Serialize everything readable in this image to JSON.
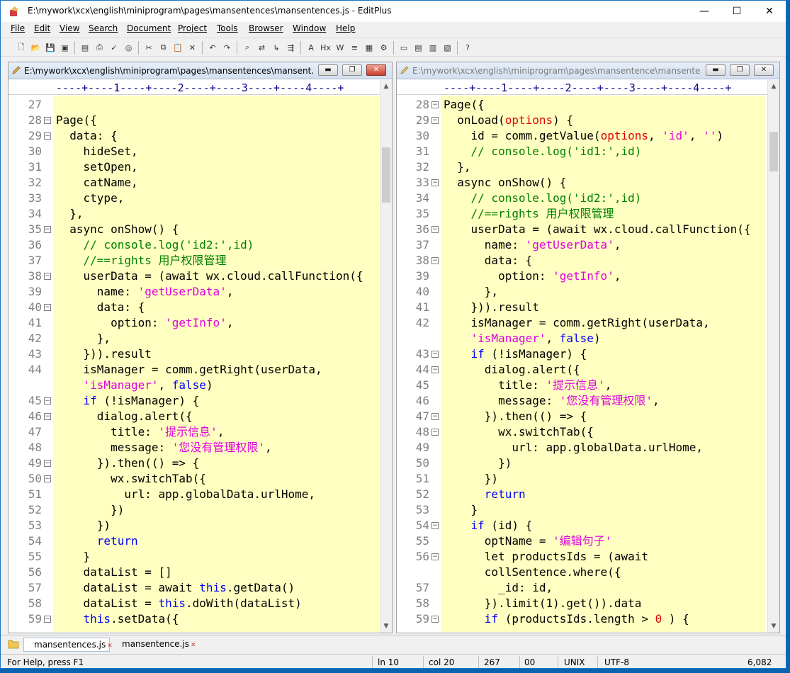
{
  "window": {
    "title": "E:\\mywork\\xcx\\english\\miniprogram\\pages\\mansentences\\mansentences.js - EditPlus",
    "minimize_glyph": "—",
    "maximize_glyph": "☐",
    "close_glyph": "✕"
  },
  "menu": [
    "File",
    "Edit",
    "View",
    "Search",
    "Document",
    "Project",
    "Tools",
    "Browser",
    "Window",
    "Help"
  ],
  "toolbar_icons": [
    "new-file-icon",
    "open-folder-icon",
    "save-icon",
    "save-all-icon",
    "print-preview-icon",
    "print-icon",
    "spell-check-icon",
    "browser-preview-icon",
    "cut-icon",
    "copy-icon",
    "paste-icon",
    "delete-icon",
    "undo-icon",
    "redo-icon",
    "find-icon",
    "replace-icon",
    "goto-icon",
    "find-in-files-icon",
    "font-icon",
    "hex-icon",
    "word-wrap-icon",
    "indent-icon",
    "column-select-icon",
    "settings-gear-icon",
    "doc-selector-icon",
    "output-window-icon",
    "cliptext-icon",
    "directory-icon",
    "help-pointer-icon"
  ],
  "left_pane": {
    "title": "E:\\mywork\\xcx\\english\\miniprogram\\pages\\mansentences\\mansent...",
    "ruler": "----+----1----+----2----+----3----+----4----+"
  },
  "right_pane": {
    "title": "E:\\mywork\\xcx\\english\\miniprogram\\pages\\mansentence\\mansente...",
    "ruler": "----+----1----+----2----+----3----+----4----+"
  },
  "left_code": [
    {
      "n": "27",
      "f": false,
      "t": []
    },
    {
      "n": "28",
      "f": true,
      "t": [
        [
          "",
          "Page({"
        ]
      ]
    },
    {
      "n": "29",
      "f": true,
      "t": [
        [
          "",
          "  data: {"
        ]
      ]
    },
    {
      "n": "30",
      "f": false,
      "t": [
        [
          "",
          "    hideSet,"
        ]
      ]
    },
    {
      "n": "31",
      "f": false,
      "t": [
        [
          "",
          "    setOpen,"
        ]
      ]
    },
    {
      "n": "32",
      "f": false,
      "t": [
        [
          "",
          "    catName,"
        ]
      ]
    },
    {
      "n": "33",
      "f": false,
      "t": [
        [
          "",
          "    ctype,"
        ]
      ]
    },
    {
      "n": "34",
      "f": false,
      "t": [
        [
          "",
          "  },"
        ]
      ]
    },
    {
      "n": "35",
      "f": true,
      "t": [
        [
          "",
          "  async onShow() {"
        ]
      ]
    },
    {
      "n": "36",
      "f": false,
      "t": [
        [
          "c",
          "    // console.log('id2:',id)"
        ]
      ]
    },
    {
      "n": "37",
      "f": false,
      "t": [
        [
          "c",
          "    //==rights 用户权限管理"
        ]
      ]
    },
    {
      "n": "38",
      "f": true,
      "t": [
        [
          "",
          "    userData = (await wx.cloud.callFunction({"
        ]
      ]
    },
    {
      "n": "39",
      "f": false,
      "t": [
        [
          "",
          "      name: "
        ],
        [
          "s",
          "'getUserData'"
        ],
        [
          "",
          ","
        ]
      ]
    },
    {
      "n": "40",
      "f": true,
      "t": [
        [
          "",
          "      data: {"
        ]
      ]
    },
    {
      "n": "41",
      "f": false,
      "t": [
        [
          "",
          "        option: "
        ],
        [
          "s",
          "'getInfo'"
        ],
        [
          "",
          ","
        ]
      ]
    },
    {
      "n": "42",
      "f": false,
      "t": [
        [
          "",
          "      },"
        ]
      ]
    },
    {
      "n": "43",
      "f": false,
      "t": [
        [
          "",
          "    })).result"
        ]
      ]
    },
    {
      "n": "44",
      "f": false,
      "t": [
        [
          "",
          "    isManager = comm.getRight(userData,"
        ]
      ]
    },
    {
      "n": "",
      "f": false,
      "t": [
        [
          "s",
          "    'isManager'"
        ],
        [
          "",
          ", "
        ],
        [
          "k",
          "false"
        ],
        [
          "",
          ")"
        ]
      ]
    },
    {
      "n": "45",
      "f": true,
      "t": [
        [
          "k",
          "    if"
        ],
        [
          "",
          " (!isManager) {"
        ]
      ]
    },
    {
      "n": "46",
      "f": true,
      "t": [
        [
          "",
          "      dialog.alert({"
        ]
      ]
    },
    {
      "n": "47",
      "f": false,
      "t": [
        [
          "",
          "        title: "
        ],
        [
          "s",
          "'提示信息'"
        ],
        [
          "",
          ","
        ]
      ]
    },
    {
      "n": "48",
      "f": false,
      "t": [
        [
          "",
          "        message: "
        ],
        [
          "s",
          "'您没有管理权限'"
        ],
        [
          "",
          ","
        ]
      ]
    },
    {
      "n": "49",
      "f": true,
      "t": [
        [
          "",
          "      }).then(() => {"
        ]
      ]
    },
    {
      "n": "50",
      "f": true,
      "t": [
        [
          "",
          "        wx.switchTab({"
        ]
      ]
    },
    {
      "n": "51",
      "f": false,
      "t": [
        [
          "",
          "          url: app.globalData.urlHome,"
        ]
      ]
    },
    {
      "n": "52",
      "f": false,
      "t": [
        [
          "",
          "        })"
        ]
      ]
    },
    {
      "n": "53",
      "f": false,
      "t": [
        [
          "",
          "      })"
        ]
      ]
    },
    {
      "n": "54",
      "f": false,
      "t": [
        [
          "k",
          "      return"
        ]
      ]
    },
    {
      "n": "55",
      "f": false,
      "t": [
        [
          "",
          "    }"
        ]
      ]
    },
    {
      "n": "56",
      "f": false,
      "t": [
        [
          "",
          "    dataList = []"
        ]
      ]
    },
    {
      "n": "57",
      "f": false,
      "t": [
        [
          "",
          "    dataList = await "
        ],
        [
          "k",
          "this"
        ],
        [
          "",
          ".getData()"
        ]
      ]
    },
    {
      "n": "58",
      "f": false,
      "t": [
        [
          "",
          "    dataList = "
        ],
        [
          "k",
          "this"
        ],
        [
          "",
          ".doWith(dataList)"
        ]
      ]
    },
    {
      "n": "59",
      "f": true,
      "t": [
        [
          "k",
          "    this"
        ],
        [
          "",
          ".setData({"
        ]
      ]
    }
  ],
  "right_code": [
    {
      "n": "28",
      "f": true,
      "t": [
        [
          "",
          "Page({"
        ]
      ]
    },
    {
      "n": "29",
      "f": true,
      "t": [
        [
          "",
          "  onLoad("
        ],
        [
          "p",
          "options"
        ],
        [
          "",
          ") {"
        ]
      ]
    },
    {
      "n": "30",
      "f": false,
      "t": [
        [
          "",
          "    id = comm.getValue("
        ],
        [
          "p",
          "options"
        ],
        [
          "",
          ", "
        ],
        [
          "s",
          "'id'"
        ],
        [
          "",
          ", "
        ],
        [
          "s",
          "''"
        ],
        [
          "",
          ")"
        ]
      ]
    },
    {
      "n": "31",
      "f": false,
      "t": [
        [
          "c",
          "    // console.log('id1:',id)"
        ]
      ]
    },
    {
      "n": "32",
      "f": false,
      "t": [
        [
          "",
          "  },"
        ]
      ]
    },
    {
      "n": "33",
      "f": true,
      "t": [
        [
          "",
          "  async onShow() {"
        ]
      ]
    },
    {
      "n": "34",
      "f": false,
      "t": [
        [
          "c",
          "    // console.log('id2:',id)"
        ]
      ]
    },
    {
      "n": "35",
      "f": false,
      "t": [
        [
          "c",
          "    //==rights 用户权限管理"
        ]
      ]
    },
    {
      "n": "36",
      "f": true,
      "t": [
        [
          "",
          "    userData = (await wx.cloud.callFunction({"
        ]
      ]
    },
    {
      "n": "37",
      "f": false,
      "t": [
        [
          "",
          "      name: "
        ],
        [
          "s",
          "'getUserData'"
        ],
        [
          "",
          ","
        ]
      ]
    },
    {
      "n": "38",
      "f": true,
      "t": [
        [
          "",
          "      data: {"
        ]
      ]
    },
    {
      "n": "39",
      "f": false,
      "t": [
        [
          "",
          "        option: "
        ],
        [
          "s",
          "'getInfo'"
        ],
        [
          "",
          ","
        ]
      ]
    },
    {
      "n": "40",
      "f": false,
      "t": [
        [
          "",
          "      },"
        ]
      ]
    },
    {
      "n": "41",
      "f": false,
      "t": [
        [
          "",
          "    })).result"
        ]
      ]
    },
    {
      "n": "42",
      "f": false,
      "t": [
        [
          "",
          "    isManager = comm.getRight(userData,"
        ]
      ]
    },
    {
      "n": "",
      "f": false,
      "t": [
        [
          "s",
          "    'isManager'"
        ],
        [
          "",
          ", "
        ],
        [
          "k",
          "false"
        ],
        [
          "",
          ")"
        ]
      ]
    },
    {
      "n": "43",
      "f": true,
      "t": [
        [
          "k",
          "    if"
        ],
        [
          "",
          " (!isManager) {"
        ]
      ]
    },
    {
      "n": "44",
      "f": true,
      "t": [
        [
          "",
          "      dialog.alert({"
        ]
      ]
    },
    {
      "n": "45",
      "f": false,
      "t": [
        [
          "",
          "        title: "
        ],
        [
          "s",
          "'提示信息'"
        ],
        [
          "",
          ","
        ]
      ]
    },
    {
      "n": "46",
      "f": false,
      "t": [
        [
          "",
          "        message: "
        ],
        [
          "s",
          "'您没有管理权限'"
        ],
        [
          "",
          ","
        ]
      ]
    },
    {
      "n": "47",
      "f": true,
      "t": [
        [
          "",
          "      }).then(() => {"
        ]
      ]
    },
    {
      "n": "48",
      "f": true,
      "t": [
        [
          "",
          "        wx.switchTab({"
        ]
      ]
    },
    {
      "n": "49",
      "f": false,
      "t": [
        [
          "",
          "          url: app.globalData.urlHome,"
        ]
      ]
    },
    {
      "n": "50",
      "f": false,
      "t": [
        [
          "",
          "        })"
        ]
      ]
    },
    {
      "n": "51",
      "f": false,
      "t": [
        [
          "",
          "      })"
        ]
      ]
    },
    {
      "n": "52",
      "f": false,
      "t": [
        [
          "k",
          "      return"
        ]
      ]
    },
    {
      "n": "53",
      "f": false,
      "t": [
        [
          "",
          "    }"
        ]
      ]
    },
    {
      "n": "54",
      "f": true,
      "t": [
        [
          "k",
          "    if"
        ],
        [
          "",
          " (id) {"
        ]
      ]
    },
    {
      "n": "55",
      "f": false,
      "t": [
        [
          "",
          "      optName = "
        ],
        [
          "s",
          "'编辑句子'"
        ]
      ]
    },
    {
      "n": "56",
      "f": true,
      "t": [
        [
          "",
          "      let productsIds = (await"
        ]
      ]
    },
    {
      "n": "",
      "f": false,
      "t": [
        [
          "",
          "      collSentence.where({"
        ]
      ]
    },
    {
      "n": "57",
      "f": false,
      "t": [
        [
          "",
          "        _id: id,"
        ]
      ]
    },
    {
      "n": "58",
      "f": false,
      "t": [
        [
          "",
          "      }).limit(1).get()).data"
        ]
      ]
    },
    {
      "n": "59",
      "f": true,
      "t": [
        [
          "k",
          "      if"
        ],
        [
          "",
          " (productsIds.length > "
        ],
        [
          "p",
          "0"
        ],
        [
          "",
          " ) {"
        ]
      ]
    }
  ],
  "tabs": [
    {
      "label": "mansentences.js",
      "active": true
    },
    {
      "label": "mansentence.js",
      "active": false
    }
  ],
  "status": {
    "help": "For Help, press F1",
    "ln": "ln 10",
    "col": "col 20",
    "chars": "267",
    "hex": "00",
    "eol": "UNIX",
    "encoding": "UTF-8",
    "size": "6,082"
  },
  "colors": {
    "keyword": "#0000ff",
    "string": "#e000e0",
    "comment": "#008000",
    "param": "#e00000",
    "code_bg": "#ffffc1"
  }
}
